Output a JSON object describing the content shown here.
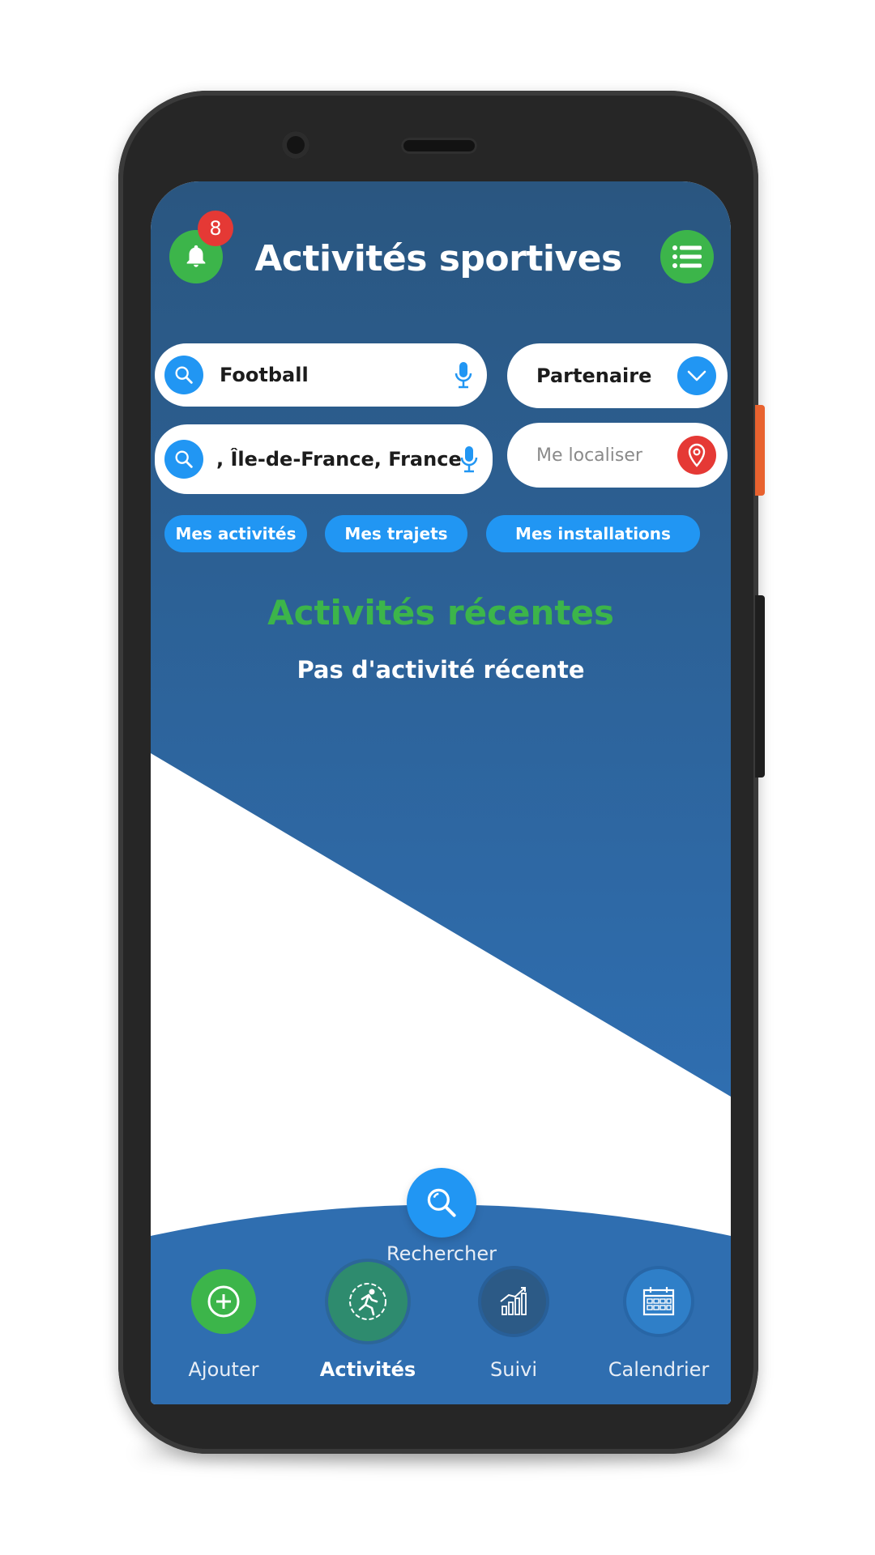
{
  "header": {
    "title": "Activités sportives",
    "notification_count": "8",
    "bell_icon": "bell-icon",
    "menu_icon": "list-menu-icon"
  },
  "search": {
    "activity": {
      "value": "Football",
      "icon": "search-icon",
      "mic_icon": "microphone-icon"
    },
    "location": {
      "value": ", Île-de-France, France",
      "icon": "search-icon",
      "mic_icon": "microphone-icon"
    },
    "partner": {
      "value": "Partenaire",
      "icon": "chevron-down-icon"
    },
    "localize": {
      "placeholder": "Me localiser",
      "icon": "map-pin-icon"
    }
  },
  "chips": [
    {
      "label": "Mes activités"
    },
    {
      "label": "Mes trajets"
    },
    {
      "label": "Mes installations"
    }
  ],
  "recent": {
    "title": "Activités récentes",
    "empty_text": "Pas d'activité récente"
  },
  "bottom_nav": {
    "search": {
      "label": "Rechercher"
    },
    "items": [
      {
        "label": "Ajouter",
        "icon": "add-circle-icon"
      },
      {
        "label": "Activités",
        "icon": "runner-icon",
        "active": true
      },
      {
        "label": "Suivi",
        "icon": "chart-icon"
      },
      {
        "label": "Calendrier",
        "icon": "calendar-icon"
      }
    ]
  },
  "colors": {
    "primary_blue": "#2196f3",
    "bg_blue_top": "#2a5680",
    "bg_blue_bottom": "#2f6eb0",
    "accent_green": "#3cb54a",
    "badge_red": "#e53935"
  }
}
